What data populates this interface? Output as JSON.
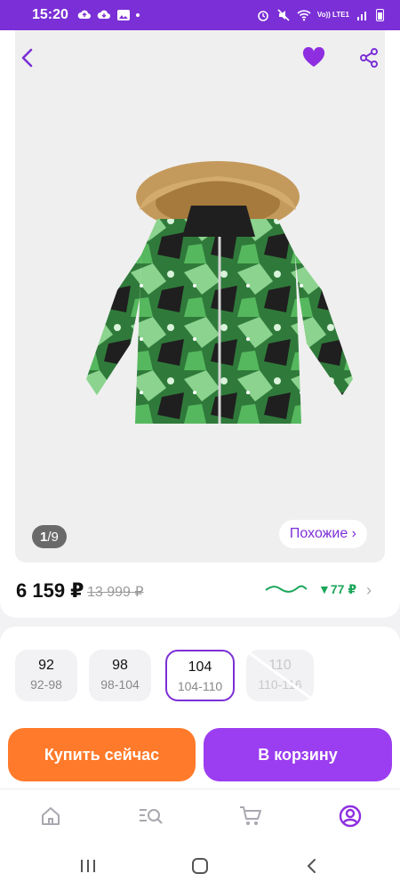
{
  "status_bar": {
    "time": "15:20",
    "network": "Vo)) LTE1"
  },
  "gallery": {
    "image_alt_icon": "winter-jacket-image",
    "counter_current": "1",
    "counter_total": "9",
    "similar_label": "Похожие ›"
  },
  "price": {
    "current": "6 159 ₽",
    "old": "13 999 ₽",
    "drop_label": "▼77 ₽"
  },
  "sizes": [
    {
      "main": "92",
      "sub": "92-98",
      "state": "available"
    },
    {
      "main": "98",
      "sub": "98-104",
      "state": "available"
    },
    {
      "main": "104",
      "sub": "104-110",
      "state": "selected"
    },
    {
      "main": "110",
      "sub": "110-116",
      "state": "unavailable"
    }
  ],
  "actions": {
    "buy_now": "Купить сейчас",
    "add_to_cart": "В корзину"
  },
  "colors": {
    "brand": "#7b2fd6",
    "buy": "#ff7a2a",
    "cart": "#9b3df0",
    "trend_green": "#1aa65a"
  },
  "bottom_nav": [
    "home-icon",
    "catalog-search-icon",
    "cart-icon",
    "profile-icon"
  ],
  "system_nav": [
    "recent-apps-icon",
    "home-button-icon",
    "back-icon"
  ]
}
